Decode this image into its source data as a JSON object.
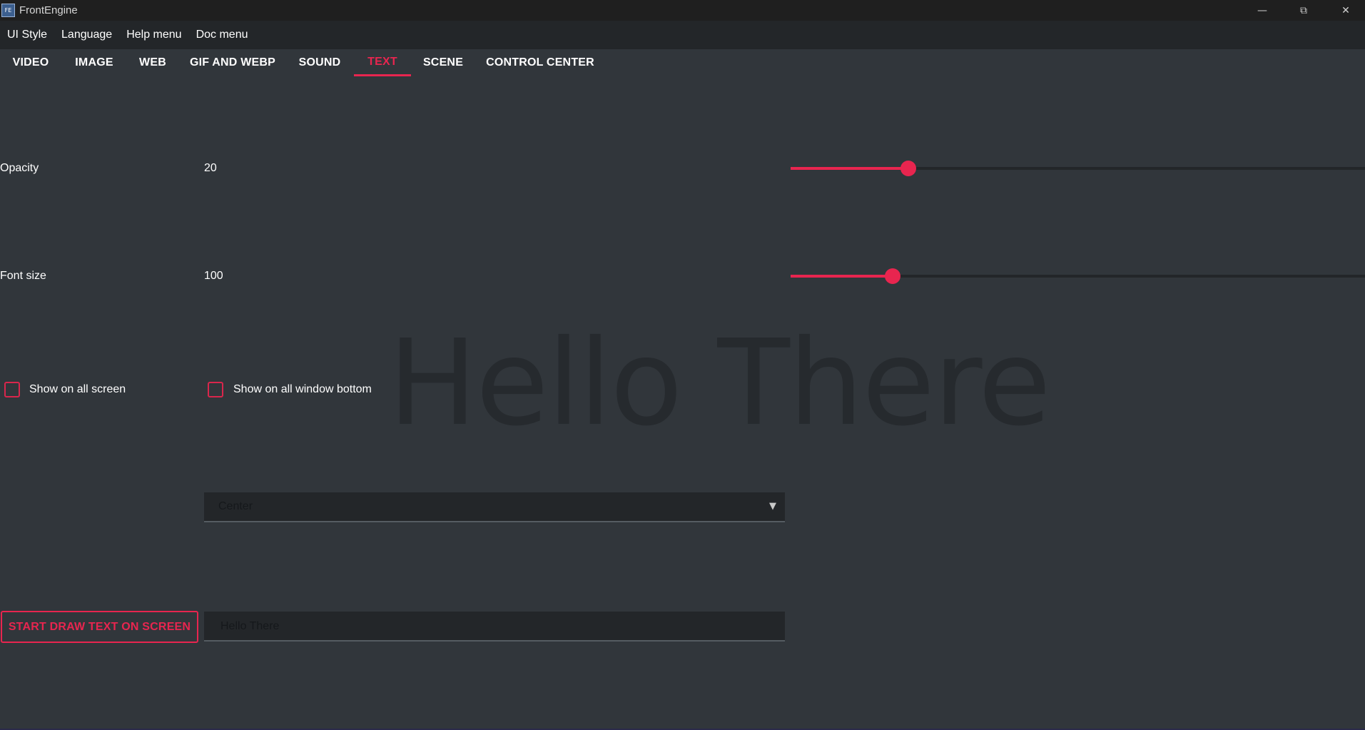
{
  "window": {
    "title": "FrontEngine",
    "icon_text": "FE",
    "minimize_icon": "minimize-icon",
    "restore_icon": "restore-icon",
    "close_icon": "close-icon"
  },
  "menubar": {
    "items": [
      "UI Style",
      "Language",
      "Help menu",
      "Doc menu"
    ]
  },
  "tabs": {
    "items": [
      "VIDEO",
      "IMAGE",
      "WEB",
      "GIF AND WEBP",
      "SOUND",
      "TEXT",
      "SCENE",
      "CONTROL CENTER"
    ],
    "active": "TEXT"
  },
  "opacity": {
    "label": "Opacity",
    "value": "20",
    "slider_fraction": 0.205
  },
  "font_size": {
    "label": "Font size",
    "value": "100",
    "slider_fraction": 0.178
  },
  "checkboxes": {
    "all_screen": {
      "label": "Show on all screen",
      "checked": false
    },
    "window_bottom": {
      "label": "Show on all window bottom",
      "checked": false
    }
  },
  "preview": {
    "text": "Hello There"
  },
  "position_select": {
    "value": "Center"
  },
  "draw_button": {
    "label": "START DRAW TEXT ON SCREEN"
  },
  "text_input": {
    "value": "Hello There"
  },
  "colors": {
    "accent": "#e8254f",
    "background": "#31363b",
    "menubar": "#232629",
    "titlebar": "#1f1f1f"
  }
}
